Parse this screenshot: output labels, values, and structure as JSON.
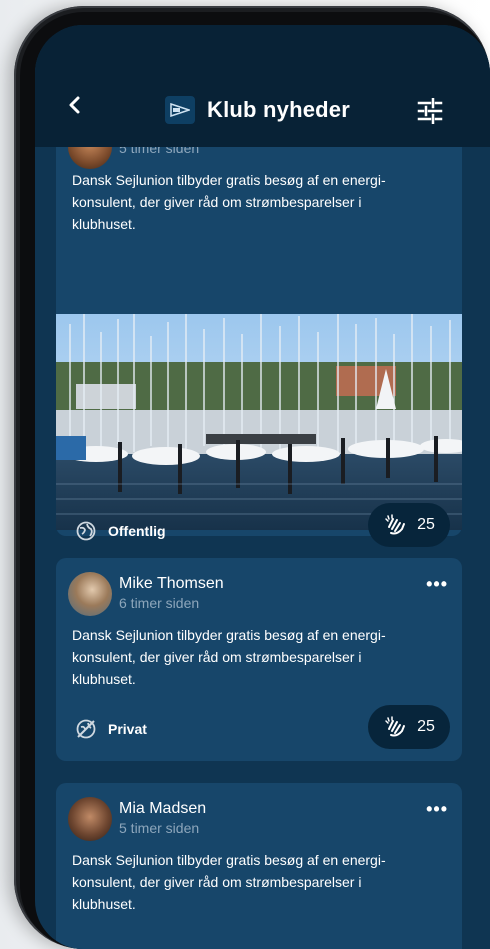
{
  "header": {
    "title": "Klub nyheder",
    "back_icon": "chevron-left-icon",
    "filter_icon": "sliders-icon"
  },
  "posts": [
    {
      "time": "5 timer siden",
      "text_lines": [
        "Dansk Sejlunion tilbyder gratis besøg af en energi-",
        "konsulent, der giver råd om strømbesparelser i",
        "klubhuset."
      ],
      "visibility": "Offentlig",
      "claps": "25"
    },
    {
      "author": "Mike Thomsen",
      "time": "6 timer siden",
      "text_lines": [
        "Dansk Sejlunion tilbyder gratis besøg af en energi-",
        "konsulent, der giver råd om strømbesparelser i",
        "klubhuset."
      ],
      "visibility": "Privat",
      "claps": "25"
    },
    {
      "author": "Mia Madsen",
      "time": "5 timer siden",
      "text_lines": [
        "Dansk Sejlunion tilbyder gratis besøg af en energi-",
        "konsulent, der giver råd om strømbesparelser i",
        "klubhuset."
      ]
    }
  ],
  "colors": {
    "screen_bg": "#0f3552",
    "card_bg": "#17466a",
    "header_bg": "#082236",
    "pill_bg": "#07253b"
  }
}
